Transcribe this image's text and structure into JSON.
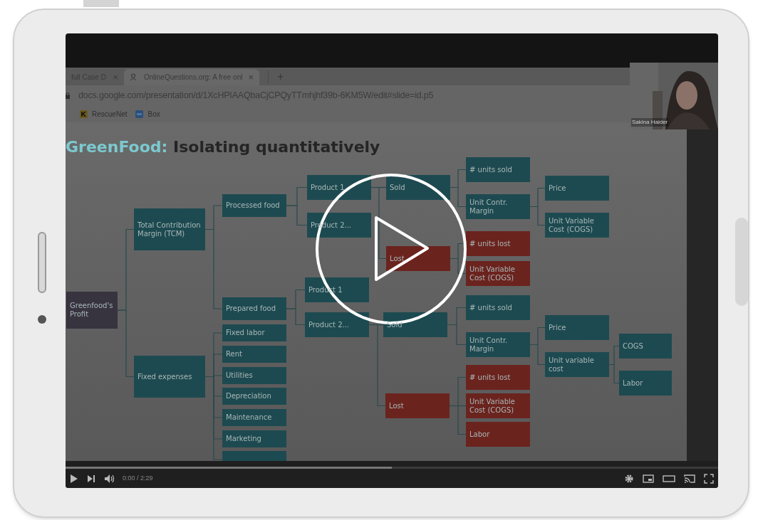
{
  "browser": {
    "tabs": [
      {
        "label": "full Case D",
        "selected": false,
        "close": "×"
      },
      {
        "label": "OnlineQuestions.org: A free onl",
        "selected": true,
        "close": "×"
      }
    ],
    "new_tab": "+",
    "url": "docs.google.com/presentation/d/1XcHPIAAQbaCjCPQyTTmhjhf39b-6KM5W/edit#slide=id.p5",
    "bookmarks": [
      {
        "label": "RescueNet",
        "kind": "rescue"
      },
      {
        "label": "Box",
        "kind": "box"
      }
    ]
  },
  "slide": {
    "title_accent": "GreenFood:",
    "title": "Isolating quantitatively",
    "tree": {
      "label": "Greenfood's Profit",
      "kind": "root",
      "children": [
        {
          "label": "Total Contribution Margin (TCM)",
          "kind": "metric",
          "children": [
            {
              "label": "Processed food",
              "kind": "metric",
              "children": [
                {
                  "label": "Product 1",
                  "kind": "metric",
                  "children": [
                    {
                      "label": "Sold",
                      "kind": "metric",
                      "children": [
                        {
                          "label": "# units sold",
                          "kind": "metric"
                        },
                        {
                          "label": "Unit Contr. Margin",
                          "kind": "metric",
                          "children": [
                            {
                              "label": "Price",
                              "kind": "metric"
                            },
                            {
                              "label": "Unit Variable Cost (COGS)",
                              "kind": "metric"
                            }
                          ]
                        }
                      ]
                    },
                    {
                      "label": "Lost",
                      "kind": "loss",
                      "children": [
                        {
                          "label": "# units lost",
                          "kind": "loss"
                        },
                        {
                          "label": "Unit Variable Cost (COGS)",
                          "kind": "loss"
                        }
                      ]
                    }
                  ]
                },
                {
                  "label": "Product 2...",
                  "kind": "metric"
                }
              ]
            },
            {
              "label": "Prepared food",
              "kind": "metric",
              "children": [
                {
                  "label": "Product 1",
                  "kind": "metric"
                },
                {
                  "label": "Product 2...",
                  "kind": "metric",
                  "children": [
                    {
                      "label": "Sold",
                      "kind": "metric",
                      "children": [
                        {
                          "label": "# units sold",
                          "kind": "metric"
                        },
                        {
                          "label": "Unit Contr. Margin",
                          "kind": "metric",
                          "children": [
                            {
                              "label": "Price",
                              "kind": "metric"
                            },
                            {
                              "label": "Unit variable cost",
                              "kind": "metric",
                              "children": [
                                {
                                  "label": "COGS",
                                  "kind": "metric"
                                },
                                {
                                  "label": "Labor",
                                  "kind": "metric"
                                }
                              ]
                            }
                          ]
                        }
                      ]
                    },
                    {
                      "label": "Lost",
                      "kind": "loss",
                      "children": [
                        {
                          "label": "# units lost",
                          "kind": "loss"
                        },
                        {
                          "label": "Unit Variable Cost (COGS)",
                          "kind": "loss"
                        },
                        {
                          "label": "Labor",
                          "kind": "loss"
                        }
                      ]
                    }
                  ]
                }
              ]
            }
          ]
        },
        {
          "label": "Fixed expenses",
          "kind": "metric",
          "children": [
            {
              "label": "Fixed labor",
              "kind": "metric"
            },
            {
              "label": "Rent",
              "kind": "metric"
            },
            {
              "label": "Utilities",
              "kind": "metric"
            },
            {
              "label": "Depreciation",
              "kind": "metric"
            },
            {
              "label": "Maintenance",
              "kind": "metric"
            },
            {
              "label": "Marketing",
              "kind": "metric"
            },
            {
              "kind": "metric"
            }
          ]
        }
      ]
    }
  },
  "webcam": {
    "name": "Sakina Haider"
  },
  "player": {
    "time": "0:00 / 2:29",
    "progress": {
      "level": 0.5
    }
  }
}
